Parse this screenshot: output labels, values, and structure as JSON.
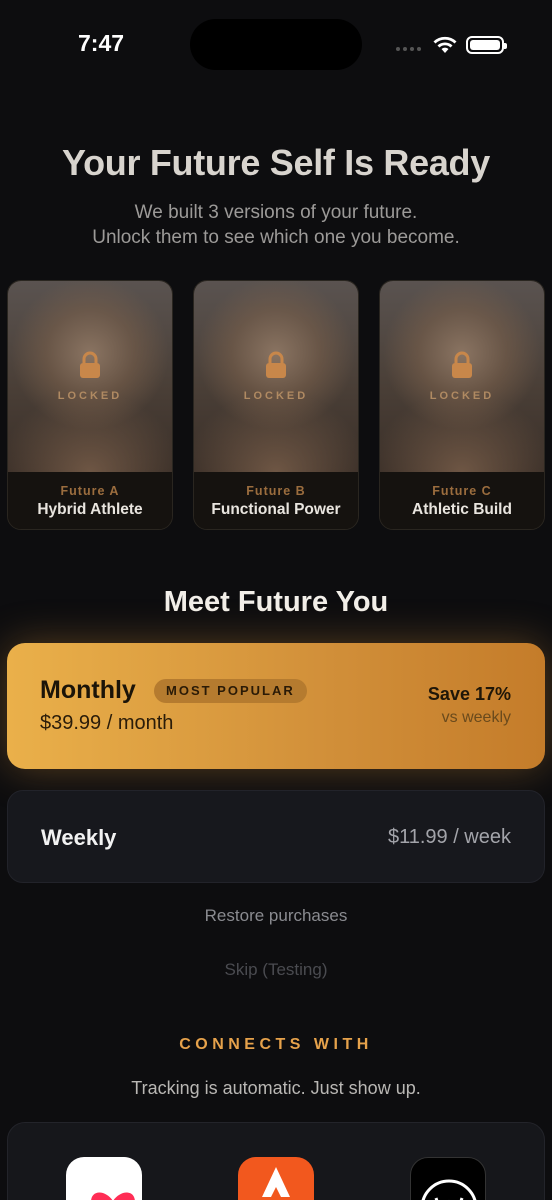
{
  "status_bar": {
    "time": "7:47"
  },
  "header": {
    "title": "Your Future Self Is Ready",
    "subtitle_line1": "We built 3 versions of your future.",
    "subtitle_line2": "Unlock them to see which one you become."
  },
  "futures": [
    {
      "locked_label": "LOCKED",
      "tag": "Future A",
      "name": "Hybrid Athlete"
    },
    {
      "locked_label": "LOCKED",
      "tag": "Future B",
      "name": "Functional Power"
    },
    {
      "locked_label": "LOCKED",
      "tag": "Future C",
      "name": "Athletic Build"
    }
  ],
  "section_title": "Meet Future You",
  "plans": {
    "monthly": {
      "label": "Monthly",
      "badge": "MOST POPULAR",
      "price": "$39.99 / month",
      "save": "Save 17%",
      "save_note": "vs weekly"
    },
    "weekly": {
      "label": "Weekly",
      "price": "$11.99 / week"
    }
  },
  "links": {
    "restore": "Restore purchases",
    "skip": "Skip (Testing)"
  },
  "integrations": {
    "heading": "CONNECTS WITH",
    "tagline": "Tracking is automatic. Just show up.",
    "apps": [
      "apple-health-icon",
      "strava-icon",
      "whoop-icon"
    ]
  },
  "colors": {
    "accent": "#E6A24B",
    "monthly_gradient_start": "#EAB04A",
    "monthly_gradient_end": "#C47C2A",
    "background": "#0D0D0F"
  }
}
